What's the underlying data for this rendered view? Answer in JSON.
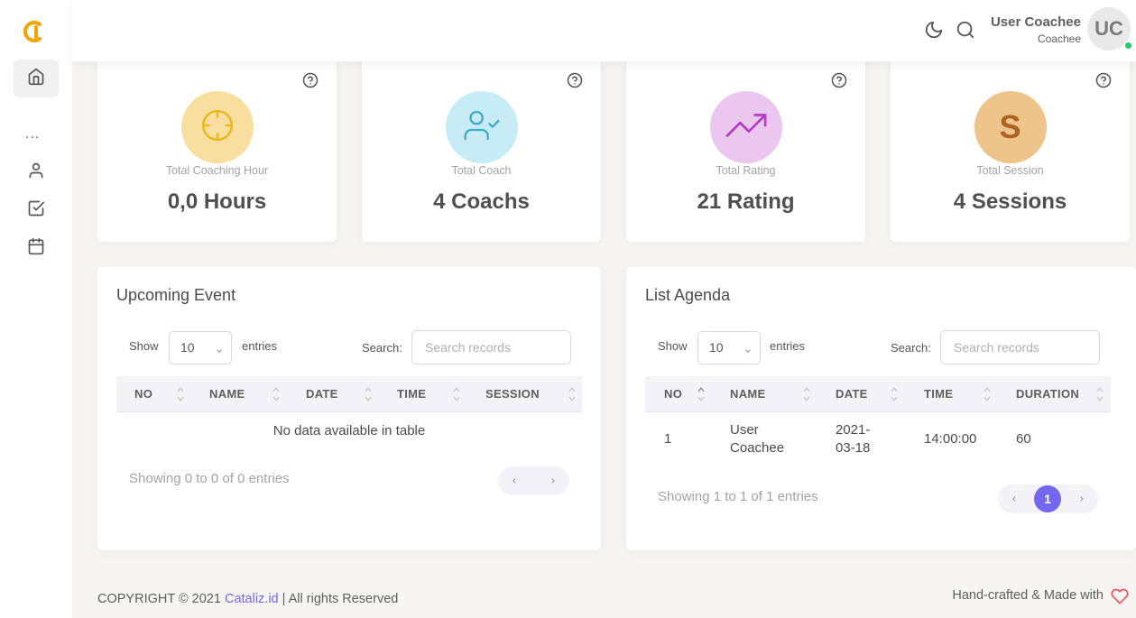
{
  "header": {
    "user_name": "User Coachee",
    "user_role": "Coachee",
    "avatar_initials": "UC"
  },
  "sidebar": {
    "items": [
      {
        "icon": "home-icon",
        "active": true
      },
      {
        "icon": "more-horizontal-icon",
        "label": "..."
      },
      {
        "icon": "user-icon"
      },
      {
        "icon": "check-square-icon"
      },
      {
        "icon": "calendar-icon"
      }
    ]
  },
  "stats": [
    {
      "label": "Total Coaching Hour",
      "value": "0,0 Hours",
      "icon": "crosshair-icon",
      "bg": "#f8df9f",
      "color": "#e8b923"
    },
    {
      "label": "Total Coach",
      "value": "4 Coachs",
      "icon": "user-check-icon",
      "bg": "#c8ecf5",
      "color": "#3fa9c8"
    },
    {
      "label": "Total Rating",
      "value": "21 Rating",
      "icon": "trending-up-icon",
      "bg": "#ebc7ef",
      "color": "#b43cc4"
    },
    {
      "label": "Total Session",
      "value": "4 Sessions",
      "icon": "s-letter-icon",
      "letter": "S",
      "bg": "#efc48a",
      "color": "#a86420"
    }
  ],
  "upcoming": {
    "title": "Upcoming Event",
    "show_label": "Show",
    "entries_value": "10",
    "entries_label": "entries",
    "search_label": "Search:",
    "search_placeholder": "Search records",
    "columns": [
      "NO",
      "NAME",
      "DATE",
      "TIME",
      "SESSION"
    ],
    "empty_text": "No data available in table",
    "info": "Showing 0 to 0 of 0 entries"
  },
  "agenda": {
    "title": "List Agenda",
    "show_label": "Show",
    "entries_value": "10",
    "entries_label": "entries",
    "search_label": "Search:",
    "search_placeholder": "Search records",
    "columns": [
      "NO",
      "NAME",
      "DATE",
      "TIME",
      "DURATION"
    ],
    "rows": [
      {
        "no": "1",
        "name_line1": "User",
        "name_line2": "Coachee",
        "date_line1": "2021-",
        "date_line2": "03-18",
        "time": "14:00:00",
        "duration": "60"
      }
    ],
    "info": "Showing 1 to 1 of 1 entries",
    "current_page": "1"
  },
  "footer": {
    "copyright_prefix": "COPYRIGHT © 2021 ",
    "brand": "Cataliz.id",
    "copyright_suffix": " | All rights Reserved",
    "made_with": "Hand-crafted & Made with"
  },
  "colors": {
    "accent": "#7367f0",
    "online": "#28c76f",
    "heart": "#ea5455",
    "logo": "#f0a500"
  }
}
